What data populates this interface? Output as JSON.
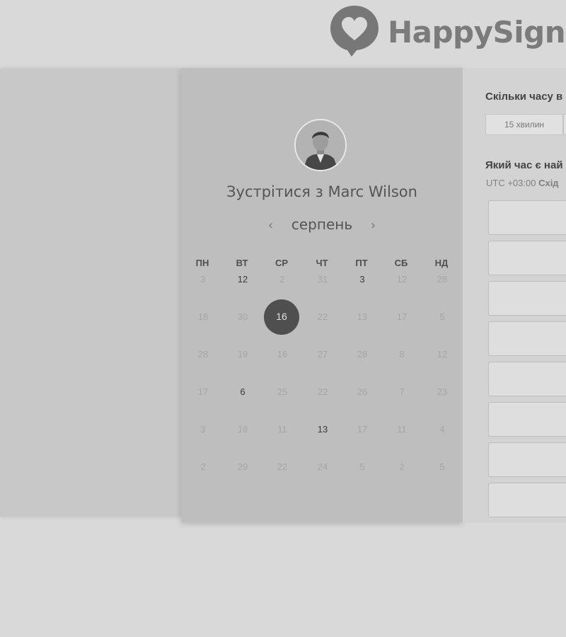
{
  "brand": {
    "name": "HappySigna"
  },
  "booking": {
    "title_prefix": "Зустрітися з",
    "host_name": "Marc Wilson",
    "month": "серпень",
    "prev_arrow": "‹",
    "next_arrow": "›",
    "weekdays": [
      "ПН",
      "ВТ",
      "СР",
      "ЧТ",
      "ПТ",
      "СБ",
      "НД"
    ],
    "weeks": [
      [
        "3",
        "12",
        "2",
        "31",
        "3",
        "12",
        "28"
      ],
      [
        "18",
        "30",
        "16",
        "22",
        "13",
        "17",
        "5"
      ],
      [
        "28",
        "19",
        "16",
        "27",
        "28",
        "8",
        "12"
      ],
      [
        "17",
        "6",
        "25",
        "22",
        "26",
        "7",
        "23"
      ],
      [
        "3",
        "18",
        "11",
        "13",
        "17",
        "11",
        "4"
      ],
      [
        "2",
        "29",
        "22",
        "24",
        "5",
        "2",
        "5"
      ]
    ],
    "available": [
      [
        0,
        1
      ],
      [
        0,
        4
      ],
      [
        3,
        1
      ],
      [
        4,
        3
      ]
    ],
    "selected": [
      1,
      2
    ]
  },
  "options": {
    "duration_question": "Скільки часу в",
    "duration_option": "15 хвилин",
    "time_question": "Який час є най",
    "timezone_offset": "UTC +03:00",
    "timezone_name": "Схід"
  },
  "colors": {
    "background": "#d9d9d9",
    "calendar_panel": "#bebebe",
    "selected_day": "#4f4f4f"
  }
}
